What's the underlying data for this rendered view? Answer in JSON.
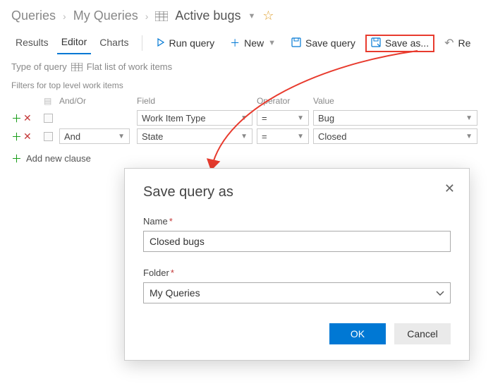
{
  "breadcrumb": {
    "root": "Queries",
    "mid": "My Queries",
    "current": "Active bugs"
  },
  "tabs": {
    "results": "Results",
    "editor": "Editor",
    "charts": "Charts"
  },
  "toolbar": {
    "run": "Run query",
    "new": "New",
    "save": "Save query",
    "saveas": "Save as...",
    "revert_initial": "Re"
  },
  "type_row": {
    "label": "Type of query",
    "mode": "Flat list of work items"
  },
  "filters": {
    "title": "Filters for top level work items",
    "headers": {
      "andor": "And/Or",
      "field": "Field",
      "operator": "Operator",
      "value": "Value"
    },
    "rows": [
      {
        "andor": "",
        "field": "Work Item Type",
        "operator": "=",
        "value": "Bug"
      },
      {
        "andor": "And",
        "field": "State",
        "operator": "=",
        "value": "Closed"
      }
    ],
    "add_clause": "Add new clause"
  },
  "dialog": {
    "title": "Save query as",
    "name_label": "Name",
    "name_value": "Closed bugs",
    "folder_label": "Folder",
    "folder_value": "My Queries",
    "ok": "OK",
    "cancel": "Cancel"
  }
}
